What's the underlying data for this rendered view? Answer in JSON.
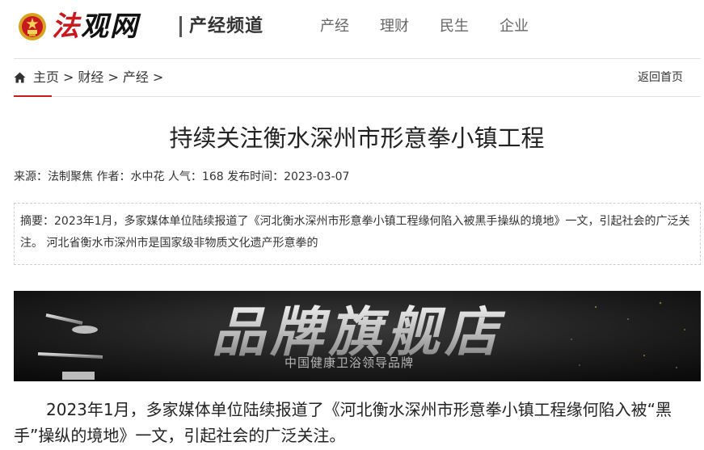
{
  "site": {
    "logo_text_part1": "法",
    "logo_text_part2": "观网",
    "channel": "产经频道"
  },
  "nav": {
    "items": [
      {
        "label": "产经"
      },
      {
        "label": "理财"
      },
      {
        "label": "民生"
      },
      {
        "label": "企业"
      }
    ]
  },
  "breadcrumb": {
    "home": "主页",
    "sep": ">",
    "level1": "财经",
    "level2": "产经",
    "back_home": "返回首页"
  },
  "article": {
    "title": "持续关注衡水深州市形意拳小镇工程",
    "meta": {
      "source_label": "来源：",
      "source": "法制聚焦",
      "author_label": " 作者：",
      "author": "水中花",
      "views_label": " 人气：",
      "views": "168",
      "date_label": " 发布时间：",
      "date": "2023-03-07"
    },
    "summary": "摘要：2023年1月，多家媒体单位陆续报道了《河北衡水深州市形意拳小镇工程缘何陷入被黑手操纵的境地》一文，引起社会的广泛关注。 河北省衡水市深州市是国家级非物质文化遗产形意拳的",
    "banner": {
      "headline": "品牌旗舰店",
      "subline": "中国健康卫浴领导品牌"
    },
    "paragraph1": "2023年1月，多家媒体单位陆续报道了《河北衡水深州市形意拳小镇工程缘何陷入被“黑手”操纵的境地》一文，引起社会的广泛关注。"
  },
  "colors": {
    "brand_red": "#c8191e",
    "text": "#333333",
    "nav_text": "#666666"
  },
  "icons": {
    "home": "home-icon",
    "emblem": "national-emblem-icon"
  }
}
